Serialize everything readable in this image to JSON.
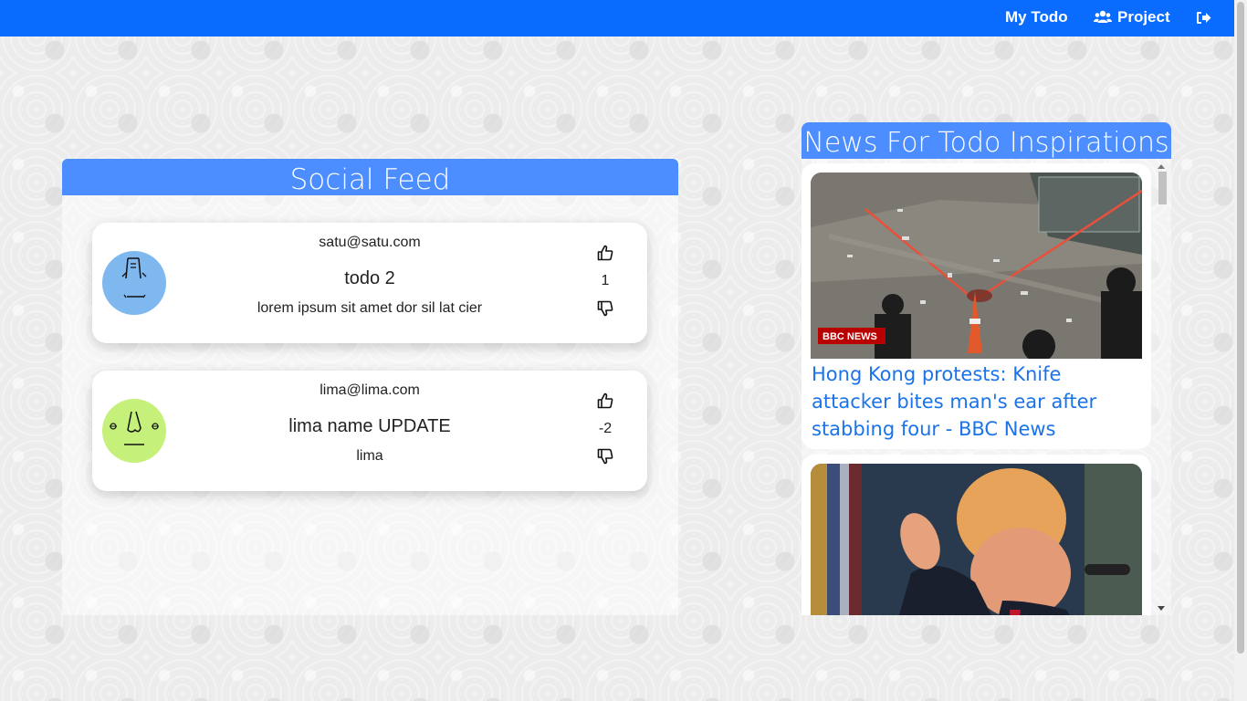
{
  "navbar": {
    "my_todo": "My Todo",
    "project": "Project"
  },
  "feed": {
    "title": "Social Feed",
    "posts": [
      {
        "email": "satu@satu.com",
        "title": "todo 2",
        "description": "lorem ipsum sit amet dor sil lat cier",
        "votes": "1",
        "avatar_color": "#7fb8ee"
      },
      {
        "email": "lima@lima.com",
        "title": "lima name UPDATE",
        "description": "lima",
        "votes": "-2",
        "avatar_color": "#c5f07a"
      }
    ]
  },
  "news": {
    "title": "News For Todo Inspirations",
    "articles": [
      {
        "headline": "Hong Kong protests: Knife attacker bites man's ear after stabbing four - BBC News",
        "badge": "BBC NEWS"
      },
      {
        "headline": ""
      }
    ]
  },
  "icons": {
    "users": "users-icon",
    "logout": "sign-out-icon",
    "like": "thumbs-up-icon",
    "dislike": "thumbs-down-icon"
  },
  "colors": {
    "navbar": "#0a6cff",
    "panel_header": "#4c8dff",
    "link": "#1a73e8"
  }
}
